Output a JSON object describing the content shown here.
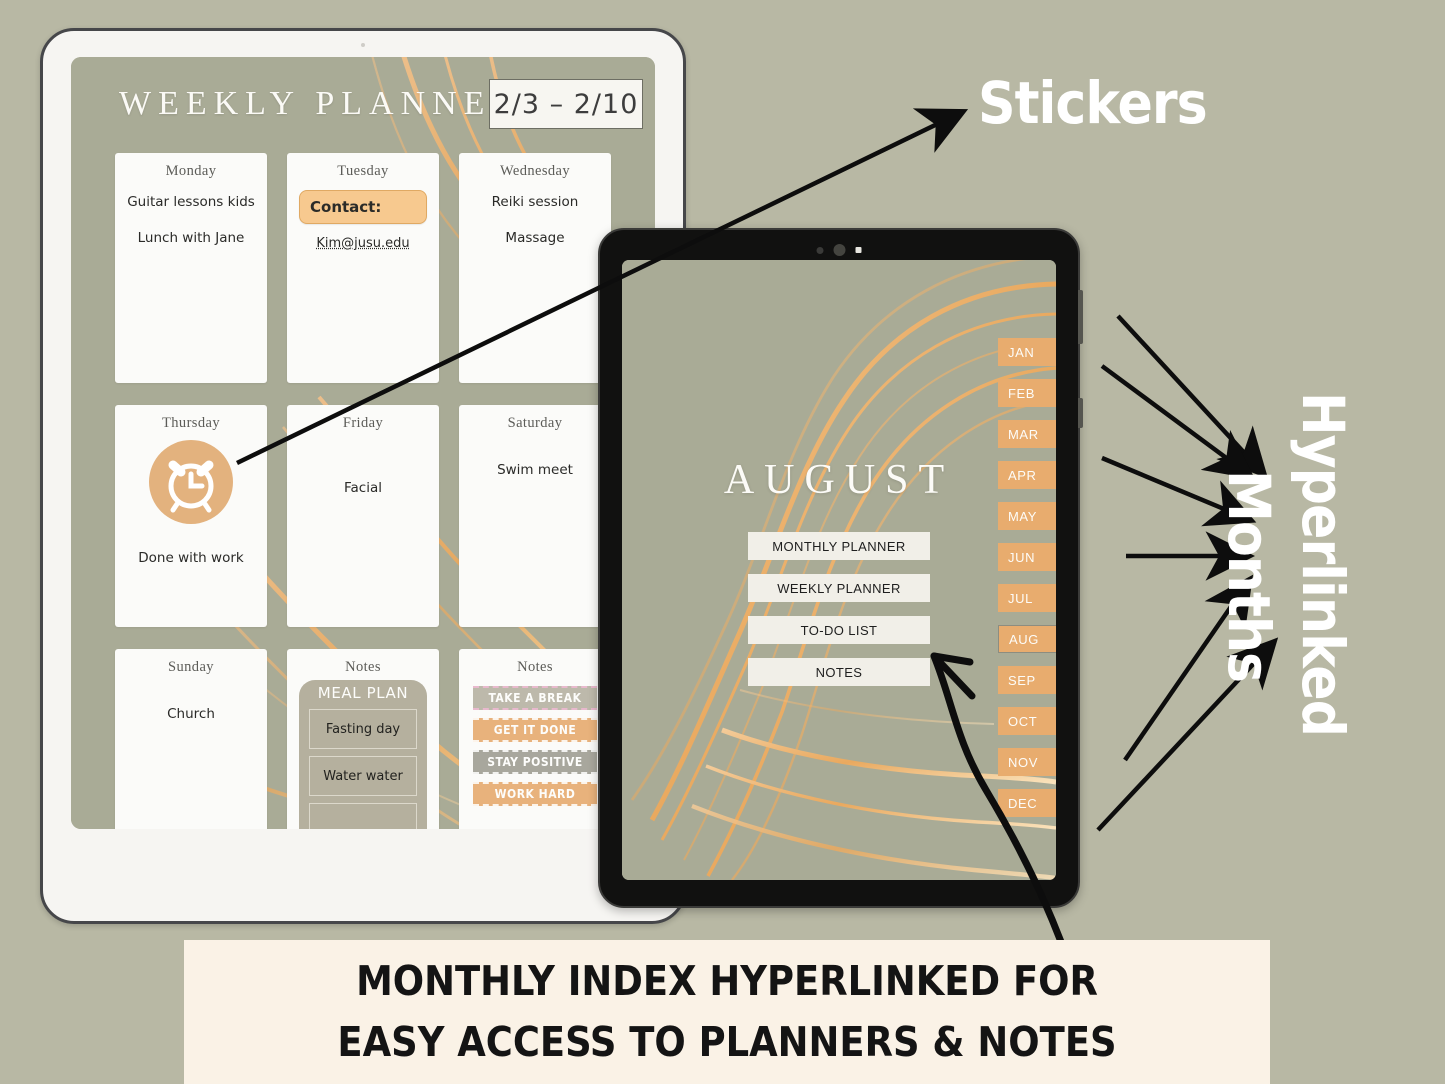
{
  "page": {
    "background_color": "#b8b8a4"
  },
  "annotations": {
    "stickers_label": "Stickers",
    "hyperlinked_label": "Hyperlinked",
    "months_label": "Months"
  },
  "caption": {
    "line1": "MONTHLY INDEX HYPERLINKED FOR",
    "line2": "EASY ACCESS TO PLANNERS & NOTES",
    "background_color": "#faf2e6"
  },
  "weekly_planner": {
    "title": "WEEKLY PLANNER",
    "date_range": "2/3 – 2/10",
    "days": [
      {
        "label": "Monday",
        "entries": [
          "Guitar lessons kids",
          "Lunch with Jane"
        ]
      },
      {
        "label": "Tuesday",
        "sticker": {
          "type": "contact-sticker",
          "text": "Contact:",
          "color": "#f7c98f"
        },
        "email": "Kim@jusu.edu",
        "entries": []
      },
      {
        "label": "Wednesday",
        "entries": [
          "Reiki session",
          "Massage"
        ]
      },
      {
        "label": "Thursday",
        "sticker": {
          "type": "alarm-clock-sticker",
          "color": "#e3b27e"
        },
        "entries": [
          "Done with work"
        ]
      },
      {
        "label": "Friday",
        "entries": [
          "Facial"
        ]
      },
      {
        "label": "Saturday",
        "entries": [
          "Swim meet"
        ]
      },
      {
        "label": "Sunday",
        "entries": [
          "Church"
        ]
      },
      {
        "label": "Notes",
        "meal_plan": {
          "title": "MEAL PLAN",
          "rows": [
            "Fasting day",
            "Water water",
            ""
          ]
        },
        "entries": []
      },
      {
        "label": "Notes",
        "quote_stickers": [
          {
            "text": "TAKE A BREAK",
            "color": "#bdb9ab",
            "border_color": "#e8b9cd"
          },
          {
            "text": "GET IT DONE",
            "color": "#e8b27c",
            "border_color": "#f3d8b5"
          },
          {
            "text": "STAY POSITIVE",
            "color": "#a8a79d",
            "border_color": "#d7d6cf"
          },
          {
            "text": "WORK HARD",
            "color": "#e8b27c",
            "border_color": "#f3d8b5"
          }
        ],
        "entries": []
      }
    ]
  },
  "monthly_index": {
    "month_title": "AUGUST",
    "menu_items": [
      "MONTHLY PLANNER",
      "WEEKLY PLANNER",
      "TO-DO LIST",
      "NOTES"
    ],
    "month_tabs": [
      {
        "label": "JAN",
        "active": false
      },
      {
        "label": "FEB",
        "active": false
      },
      {
        "label": "MAR",
        "active": false
      },
      {
        "label": "APR",
        "active": false
      },
      {
        "label": "MAY",
        "active": false
      },
      {
        "label": "JUN",
        "active": false
      },
      {
        "label": "JUL",
        "active": false
      },
      {
        "label": "AUG",
        "active": true
      },
      {
        "label": "SEP",
        "active": false
      },
      {
        "label": "OCT",
        "active": false
      },
      {
        "label": "NOV",
        "active": false
      },
      {
        "label": "DEC",
        "active": false
      }
    ],
    "tab_color": "#e8ac6e",
    "menu_color": "#f1efe8"
  }
}
